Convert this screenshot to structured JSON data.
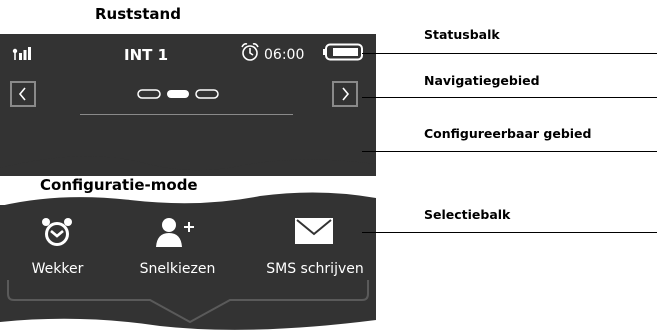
{
  "titles": {
    "idle": "Ruststand",
    "config": "Configuratie-mode"
  },
  "idle_screen": {
    "status_title": "INT 1",
    "time": "06:00"
  },
  "config_screen": {
    "items": [
      {
        "label": "Wekker",
        "icon": "alarm-clock-icon"
      },
      {
        "label": "Snelkiezen",
        "icon": "speed-dial-icon"
      },
      {
        "label": "SMS schrijven",
        "icon": "envelope-icon"
      }
    ]
  },
  "callouts": {
    "status": "Statusbalk",
    "navigation": "Navigatiegebied",
    "configurable": "Configureerbaar gebied",
    "selection": "Selectiebalk"
  },
  "colors": {
    "screen_bg": "#333333",
    "frame_gray": "#8a8a8a",
    "text": "#ffffff"
  }
}
